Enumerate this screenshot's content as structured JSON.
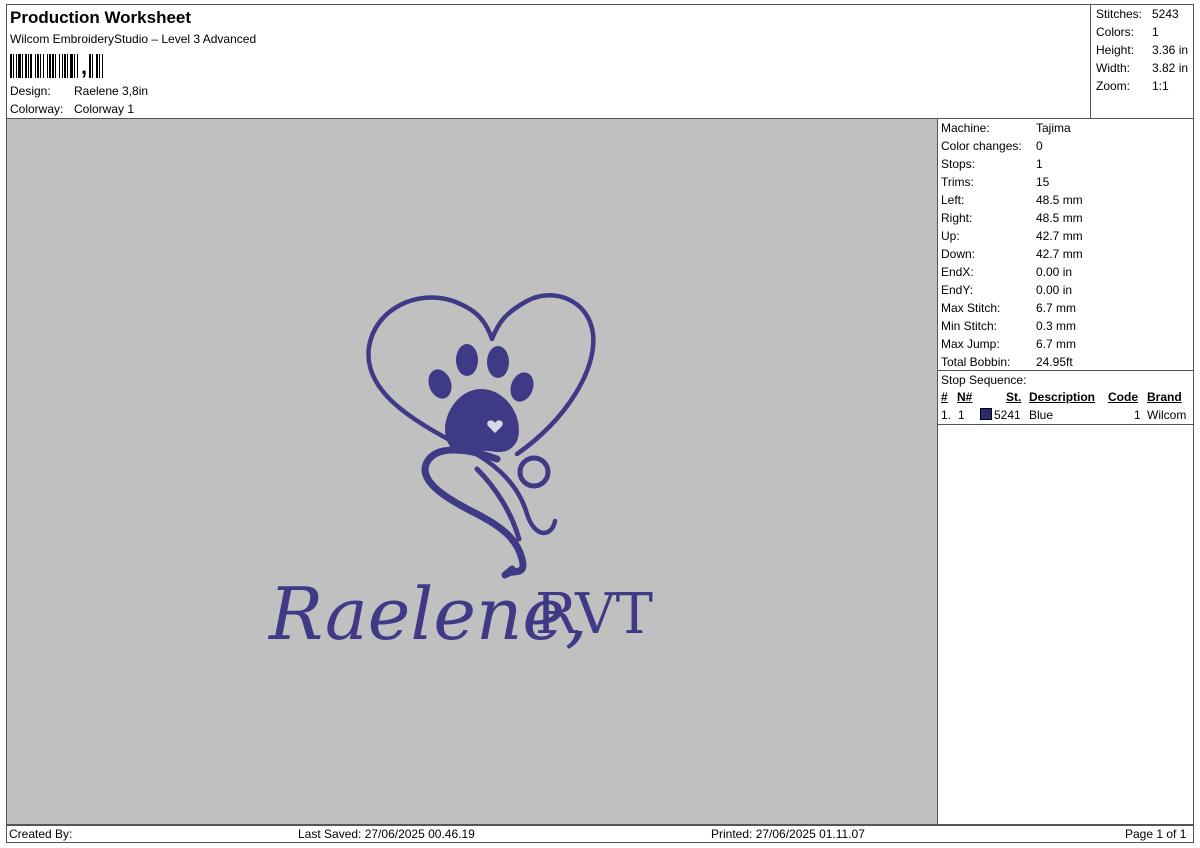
{
  "header": {
    "title": "Production Worksheet",
    "software": "Wilcom EmbroideryStudio – Level 3 Advanced",
    "design_label": "Design:",
    "design_value": "Raelene 3,8in",
    "colorway_label": "Colorway:",
    "colorway_value": "Colorway 1"
  },
  "stats": [
    {
      "label": "Stitches:",
      "value": "5243"
    },
    {
      "label": "Colors:",
      "value": "1"
    },
    {
      "label": "Height:",
      "value": "3.36 in"
    },
    {
      "label": "Width:",
      "value": "3.82 in"
    },
    {
      "label": "Zoom:",
      "value": "1:1"
    }
  ],
  "properties": [
    {
      "label": "Machine:",
      "value": "Tajima"
    },
    {
      "label": "Color changes:",
      "value": "0"
    },
    {
      "label": "Stops:",
      "value": "1"
    },
    {
      "label": "Trims:",
      "value": "15"
    },
    {
      "label": "Left:",
      "value": "48.5 mm"
    },
    {
      "label": "Right:",
      "value": "48.5 mm"
    },
    {
      "label": "Up:",
      "value": "42.7 mm"
    },
    {
      "label": "Down:",
      "value": "42.7 mm"
    },
    {
      "label": "EndX:",
      "value": "0.00 in"
    },
    {
      "label": "EndY:",
      "value": "0.00 in"
    },
    {
      "label": "Max Stitch:",
      "value": "6.7 mm"
    },
    {
      "label": "Min Stitch:",
      "value": "0.3 mm"
    },
    {
      "label": "Max Jump:",
      "value": "6.7 mm"
    },
    {
      "label": "Total Bobbin:",
      "value": "24.95ft"
    }
  ],
  "stop_sequence": {
    "title": "Stop Sequence:",
    "headers": {
      "num": "#",
      "n": "N#",
      "st": "St.",
      "description": "Description",
      "code": "Code",
      "brand": "Brand"
    },
    "rows": [
      {
        "num": "1.",
        "n": "1",
        "st": "5241",
        "description": "Blue",
        "code": "1",
        "brand": "Wilcom",
        "color": "#2b2a6e"
      }
    ]
  },
  "design": {
    "text_script": "Raelene,",
    "text_serif": "RVT",
    "thread_color": "#3f3a86"
  },
  "footer": {
    "created_by": "Created By:",
    "last_saved": "Last Saved: 27/06/2025 00.46.19",
    "printed": "Printed: 27/06/2025 01.11.07",
    "page": "Page 1 of 1"
  }
}
